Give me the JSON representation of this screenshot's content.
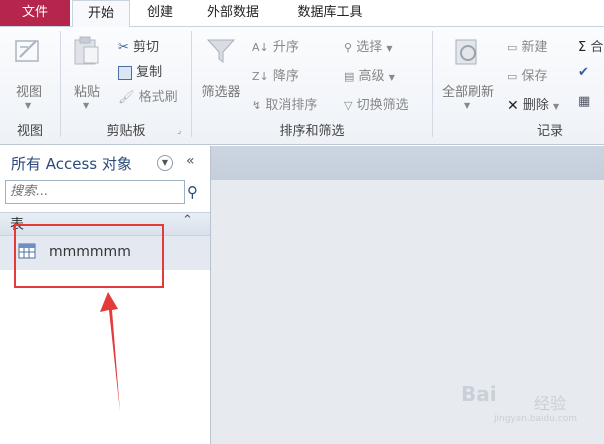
{
  "tabs": {
    "file": "文件",
    "items": [
      "开始",
      "创建",
      "外部数据",
      "数据库工具"
    ]
  },
  "ribbon": {
    "view": {
      "label": "视图",
      "group": "视图"
    },
    "clipboard": {
      "paste": "粘贴",
      "cut": "剪切",
      "copy": "复制",
      "format_painter": "格式刷",
      "group": "剪贴板"
    },
    "sort_filter": {
      "filter": "筛选器",
      "ascending": "升序",
      "descending": "降序",
      "remove_sort": "取消排序",
      "selection": "选择",
      "advanced": "高级",
      "toggle_filter": "切换筛选",
      "group": "排序和筛选"
    },
    "records": {
      "refresh_all": "全部刷新",
      "new": "新建",
      "save": "保存",
      "delete": "删除",
      "group": "记录",
      "sum_partial": "合"
    }
  },
  "nav": {
    "title": "所有 Access 对象",
    "search_placeholder": "搜索...",
    "section": "表",
    "items": [
      {
        "name": "mmmmmm"
      }
    ]
  },
  "watermark": {
    "brand": "Bai",
    "sub": "经验",
    "url": "jingyan.baidu.com"
  },
  "colors": {
    "file_tab": "#b5254c",
    "annotation": "#e43a3a",
    "nav_title": "#2b4a7a"
  }
}
